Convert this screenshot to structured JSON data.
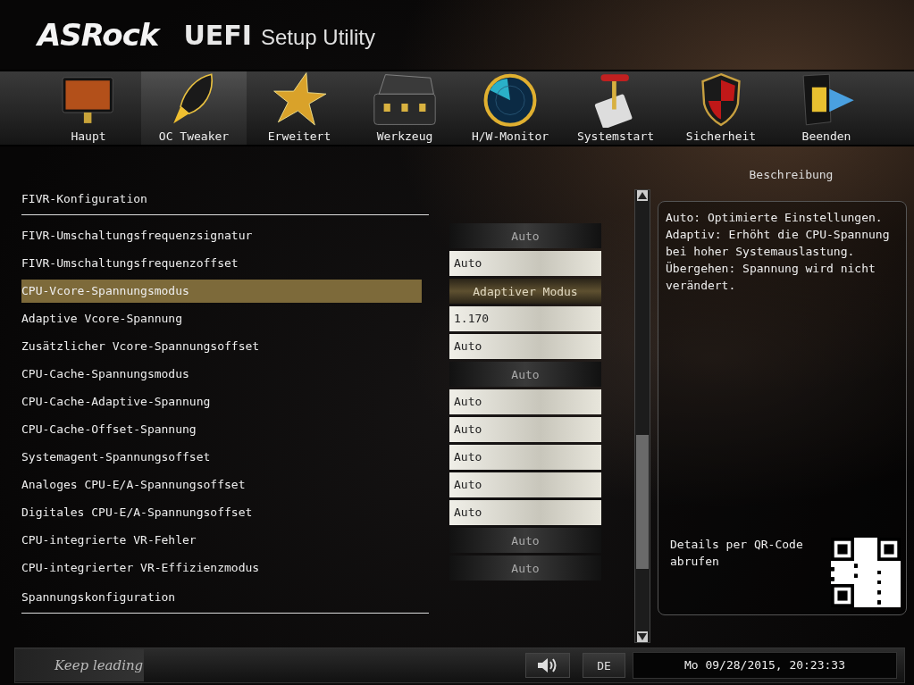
{
  "header": {
    "brand": "ASRock",
    "product": "UEFI",
    "subtitle": "Setup Utility"
  },
  "tabs": [
    {
      "label": "Haupt",
      "selected": false
    },
    {
      "label": "OC Tweaker",
      "selected": true
    },
    {
      "label": "Erweitert",
      "selected": false
    },
    {
      "label": "Werkzeug",
      "selected": false
    },
    {
      "label": "H/W-Monitor",
      "selected": false
    },
    {
      "label": "Systemstart",
      "selected": false
    },
    {
      "label": "Sicherheit",
      "selected": false
    },
    {
      "label": "Beenden",
      "selected": false
    }
  ],
  "settings": {
    "section_title": "FIVR-Konfiguration",
    "rows": [
      {
        "label": "FIVR-Umschaltungsfrequenzsignatur",
        "value": "Auto",
        "kind": "dropdown",
        "selected": false
      },
      {
        "label": "FIVR-Umschaltungsfrequenzoffset",
        "value": "Auto",
        "kind": "input",
        "selected": false
      },
      {
        "label": "CPU-Vcore-Spannungsmodus",
        "value": "Adaptiver Modus",
        "kind": "dropdown",
        "selected": true
      },
      {
        "label": "Adaptive Vcore-Spannung",
        "value": "1.170",
        "kind": "input",
        "selected": false
      },
      {
        "label": "Zusätzlicher Vcore-Spannungsoffset",
        "value": "Auto",
        "kind": "input",
        "selected": false
      },
      {
        "label": "CPU-Cache-Spannungsmodus",
        "value": "Auto",
        "kind": "dropdown",
        "selected": false
      },
      {
        "label": "CPU-Cache-Adaptive-Spannung",
        "value": "Auto",
        "kind": "input",
        "selected": false
      },
      {
        "label": "CPU-Cache-Offset-Spannung",
        "value": "Auto",
        "kind": "input",
        "selected": false
      },
      {
        "label": "Systemagent-Spannungsoffset",
        "value": "Auto",
        "kind": "input",
        "selected": false
      },
      {
        "label": "Analoges CPU-E/A-Spannungsoffset",
        "value": "Auto",
        "kind": "input",
        "selected": false
      },
      {
        "label": "Digitales CPU-E/A-Spannungsoffset",
        "value": "Auto",
        "kind": "input",
        "selected": false
      },
      {
        "label": "CPU-integrierte VR-Fehler",
        "value": "Auto",
        "kind": "dropdown",
        "selected": false
      },
      {
        "label": "CPU-integrierter VR-Effizienzmodus",
        "value": "Auto",
        "kind": "dropdown",
        "selected": false
      }
    ],
    "next_section_title": "Spannungskonfiguration"
  },
  "description": {
    "title": "Beschreibung",
    "text": "Auto: Optimierte Einstellungen.\nAdaptiv: Erhöht die CPU-Spannung bei hoher Systemauslastung.\nÜbergehen: Spannung wird nicht verändert.",
    "qr_label": "Details per QR-Code abrufen"
  },
  "status_bar": {
    "slogan": "Keep leading",
    "language": "DE",
    "datetime": "Mo 09/28/2015, 20:23:33"
  }
}
